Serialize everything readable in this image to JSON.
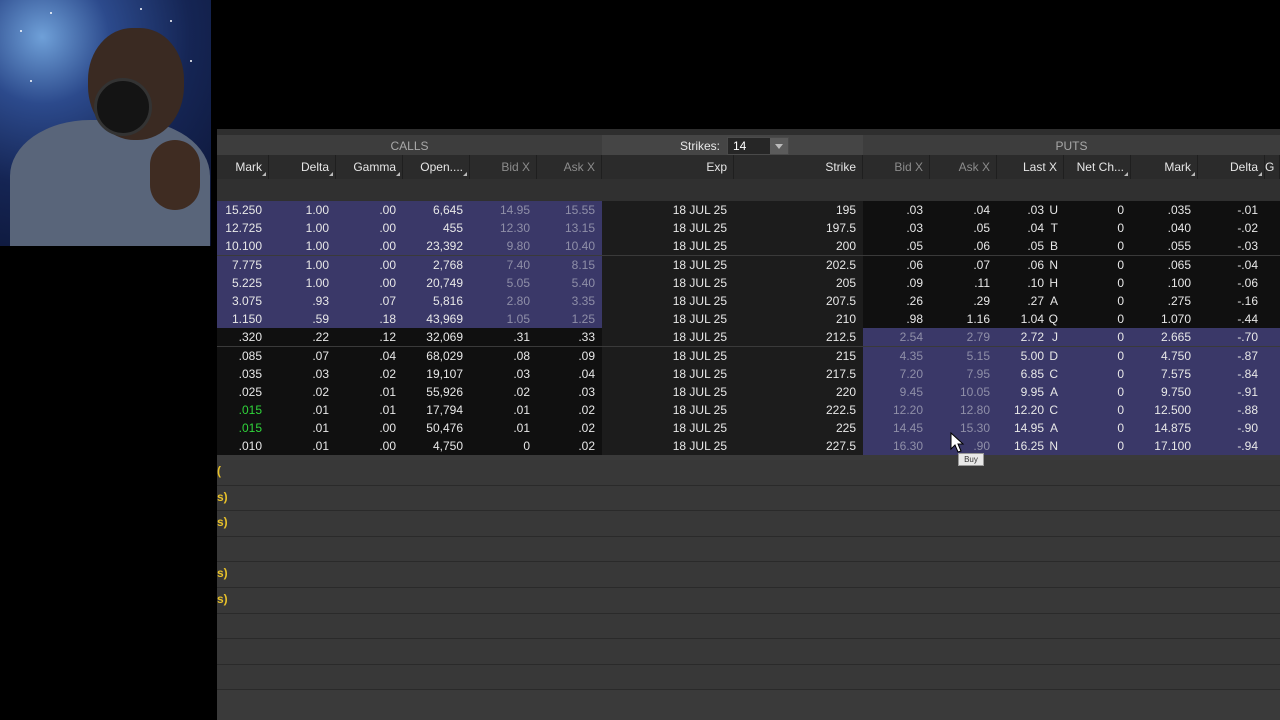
{
  "header": {
    "calls": "CALLS",
    "puts": "PUTS",
    "strikes_label": "Strikes:",
    "strikes_value": "14"
  },
  "columns": {
    "calls": [
      "Mark",
      "Delta",
      "Gamma",
      "Open....",
      "Bid X",
      "Ask X"
    ],
    "mid": [
      "Exp",
      "Strike"
    ],
    "puts": [
      "Bid X",
      "Ask X",
      "Last X",
      "Net Ch...",
      "Mark",
      "Delta",
      "G"
    ]
  },
  "rows": [
    {
      "c": [
        "15.250",
        "1.00",
        ".00",
        "6,645",
        "14.95",
        "15.55"
      ],
      "exp": "18 JUL 25",
      "strike": "195",
      "p": [
        ".03",
        ".04",
        ".03",
        "U",
        "0",
        ".035",
        "-.01"
      ],
      "itm": "call"
    },
    {
      "c": [
        "12.725",
        "1.00",
        ".00",
        "455",
        "12.30",
        "13.15"
      ],
      "exp": "18 JUL 25",
      "strike": "197.5",
      "p": [
        ".03",
        ".05",
        ".04",
        "T",
        "0",
        ".040",
        "-.02"
      ],
      "itm": "call"
    },
    {
      "c": [
        "10.100",
        "1.00",
        ".00",
        "23,392",
        "9.80",
        "10.40"
      ],
      "exp": "18 JUL 25",
      "strike": "200",
      "p": [
        ".05",
        ".06",
        ".05",
        "B",
        "0",
        ".055",
        "-.03"
      ],
      "itm": "call"
    },
    {
      "c": [
        "7.775",
        "1.00",
        ".00",
        "2,768",
        "7.40",
        "8.15"
      ],
      "exp": "18 JUL 25",
      "strike": "202.5",
      "p": [
        ".06",
        ".07",
        ".06",
        "N",
        "0",
        ".065",
        "-.04"
      ],
      "itm": "call"
    },
    {
      "c": [
        "5.225",
        "1.00",
        ".00",
        "20,749",
        "5.05",
        "5.40"
      ],
      "exp": "18 JUL 25",
      "strike": "205",
      "p": [
        ".09",
        ".11",
        ".10",
        "H",
        "0",
        ".100",
        "-.06"
      ],
      "itm": "call"
    },
    {
      "c": [
        "3.075",
        ".93",
        ".07",
        "5,816",
        "2.80",
        "3.35"
      ],
      "exp": "18 JUL 25",
      "strike": "207.5",
      "p": [
        ".26",
        ".29",
        ".27",
        "A",
        "0",
        ".275",
        "-.16"
      ],
      "itm": "call"
    },
    {
      "c": [
        "1.150",
        ".59",
        ".18",
        "43,969",
        "1.05",
        "1.25"
      ],
      "exp": "18 JUL 25",
      "strike": "210",
      "p": [
        ".98",
        "1.16",
        "1.04",
        "Q",
        "0",
        "1.070",
        "-.44"
      ],
      "itm": "call"
    },
    {
      "c": [
        ".320",
        ".22",
        ".12",
        "32,069",
        ".31",
        ".33"
      ],
      "exp": "18 JUL 25",
      "strike": "212.5",
      "p": [
        "2.54",
        "2.79",
        "2.72",
        "J",
        "0",
        "2.665",
        "-.70"
      ],
      "itm": "put"
    },
    {
      "c": [
        ".085",
        ".07",
        ".04",
        "68,029",
        ".08",
        ".09"
      ],
      "exp": "18 JUL 25",
      "strike": "215",
      "p": [
        "4.35",
        "5.15",
        "5.00",
        "D",
        "0",
        "4.750",
        "-.87"
      ],
      "itm": "put"
    },
    {
      "c": [
        ".035",
        ".03",
        ".02",
        "19,107",
        ".03",
        ".04"
      ],
      "exp": "18 JUL 25",
      "strike": "217.5",
      "p": [
        "7.20",
        "7.95",
        "6.85",
        "C",
        "0",
        "7.575",
        "-.84"
      ],
      "itm": "put"
    },
    {
      "c": [
        ".025",
        ".02",
        ".01",
        "55,926",
        ".02",
        ".03"
      ],
      "exp": "18 JUL 25",
      "strike": "220",
      "p": [
        "9.45",
        "10.05",
        "9.95",
        "A",
        "0",
        "9.750",
        "-.91"
      ],
      "itm": "put"
    },
    {
      "c": [
        ".015",
        ".01",
        ".01",
        "17,794",
        ".01",
        ".02"
      ],
      "exp": "18 JUL 25",
      "strike": "222.5",
      "p": [
        "12.20",
        "12.80",
        "12.20",
        "C",
        "0",
        "12.500",
        "-.88"
      ],
      "itm": "put",
      "green": true
    },
    {
      "c": [
        ".015",
        ".01",
        ".00",
        "50,476",
        ".01",
        ".02"
      ],
      "exp": "18 JUL 25",
      "strike": "225",
      "p": [
        "14.45",
        "15.30",
        "14.95",
        "A",
        "0",
        "14.875",
        "-.90"
      ],
      "itm": "put",
      "green": true
    },
    {
      "c": [
        ".010",
        ".01",
        ".00",
        "4,750",
        "0",
        ".02"
      ],
      "exp": "18 JUL 25",
      "strike": "227.5",
      "p": [
        "16.30",
        ".90",
        "16.25",
        "N",
        "0",
        "17.100",
        "-.94"
      ],
      "itm": "put"
    }
  ],
  "sub_rows": [
    "(",
    "s)",
    "s)",
    "",
    "s)",
    "s)",
    "",
    "",
    ""
  ],
  "tooltip": "Buy"
}
